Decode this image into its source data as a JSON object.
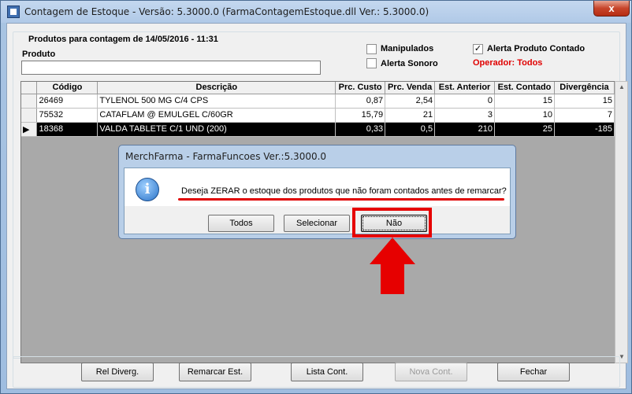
{
  "window": {
    "title": "Contagem de Estoque - Versão: 5.3000.0 (FarmaContagemEstoque.dll Ver.: 5.3000.0)",
    "close_label": "x"
  },
  "group": {
    "title": "Produtos para contagem de 14/05/2016 - 11:31",
    "produto_label": "Produto",
    "produto_value": ""
  },
  "options": {
    "manipulados": {
      "label": "Manipulados",
      "checked": false
    },
    "alerta_contado": {
      "label": "Alerta Produto Contado",
      "checked": true
    },
    "alerta_sonoro": {
      "label": "Alerta Sonoro",
      "checked": false
    },
    "operador": "Operador: Todos"
  },
  "table": {
    "columns": [
      "Código",
      "Descrição",
      "Prc. Custo",
      "Prc. Venda",
      "Est. Anterior",
      "Est. Contado",
      "Divergência"
    ],
    "rows": [
      [
        "26469",
        "TYLENOL 500 MG C/4 CPS",
        "0,87",
        "2,54",
        "0",
        "15",
        "15"
      ],
      [
        "75532",
        "CATAFLAM @ EMULGEL C/60GR",
        "15,79",
        "21",
        "3",
        "10",
        "7"
      ],
      [
        "18368",
        "VALDA TABLETE C/1 UND (200)",
        "0,33",
        "0,5",
        "210",
        "25",
        "-185"
      ]
    ],
    "selected_row": 2
  },
  "buttons": {
    "rel_diverg": "Rel Diverg.",
    "remarcar": "Remarcar Est.",
    "lista_cont": "Lista Cont.",
    "nova_cont": "Nova Cont.",
    "fechar": "Fechar"
  },
  "dialog": {
    "title": "MerchFarma - FarmaFuncoes  Ver.:5.3000.0",
    "message": "Deseja ZERAR o estoque dos produtos que não foram contados antes de remarcar?",
    "icon_glyph": "i",
    "buttons": {
      "todos": "Todos",
      "selecionar": "Selecionar",
      "nao": "Não"
    }
  },
  "colors": {
    "highlight": "#e60000",
    "operador": "#e00000",
    "selected_row": "#000000"
  },
  "icons": {
    "dialog": "info-icon",
    "annotation": "up-arrow-icon"
  }
}
